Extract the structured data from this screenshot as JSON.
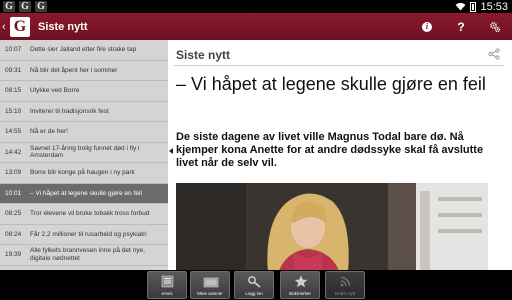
{
  "status_bar": {
    "time": "15:53",
    "app_icon_letter": "G"
  },
  "action_bar": {
    "title": "Siste nytt",
    "info_glyph": "i",
    "help_glyph": "?"
  },
  "news_list": [
    {
      "time": "10:07",
      "title": "Dette sier Jalland etter fire strake tap"
    },
    {
      "time": "09:31",
      "title": "Nå blir det åpent her i sommer"
    },
    {
      "time": "08:15",
      "title": "Ulykke ved Borre"
    },
    {
      "time": "15:10",
      "title": "Inviterer til tradisjonsrik fest"
    },
    {
      "time": "14:55",
      "title": "Nå er de her!"
    },
    {
      "time": "14:42",
      "title": "Savnet 17-åring trolig funnet død i fly i Amsterdam"
    },
    {
      "time": "13:09",
      "title": "Borre blir konge på haugen i ny park"
    },
    {
      "time": "10:01",
      "title": "– Vi håpet at legene skulle gjøre en feil",
      "active": true
    },
    {
      "time": "08:25",
      "title": "Tror elevene vil bruke tobakk tross forbud"
    },
    {
      "time": "08:24",
      "title": "Får 2,2 millioner til rusarbeid og psykiatri"
    },
    {
      "time": "19:39",
      "title": "Alle fylkets brannvesen inne på det nye, digitale nødnettet"
    }
  ],
  "article": {
    "section": "Siste nytt",
    "title": "– Vi håpet at legene skulle gjøre en feil",
    "lead": "De siste dagene av livet ville Magnus Todal bare dø. Nå kjemper kona Anette for at andre dødssyke skal få avslutte livet når de selv vil."
  },
  "bottom_bar": {
    "buttons": [
      {
        "label": "eAvis",
        "icon": "newspaper-icon",
        "enabled": true
      },
      {
        "label": "Mine avisner",
        "icon": "folder-icon",
        "enabled": true
      },
      {
        "label": "Logg inn",
        "icon": "key-icon",
        "enabled": true
      },
      {
        "label": "Bokmerker",
        "icon": "star-icon",
        "enabled": true
      },
      {
        "label": "Gratis nytt",
        "icon": "rss-icon",
        "enabled": false
      }
    ]
  },
  "colors": {
    "brand": "#7a1426",
    "sidebar_bg": "#d4d4d4",
    "active_item": "#6b6b6b"
  }
}
